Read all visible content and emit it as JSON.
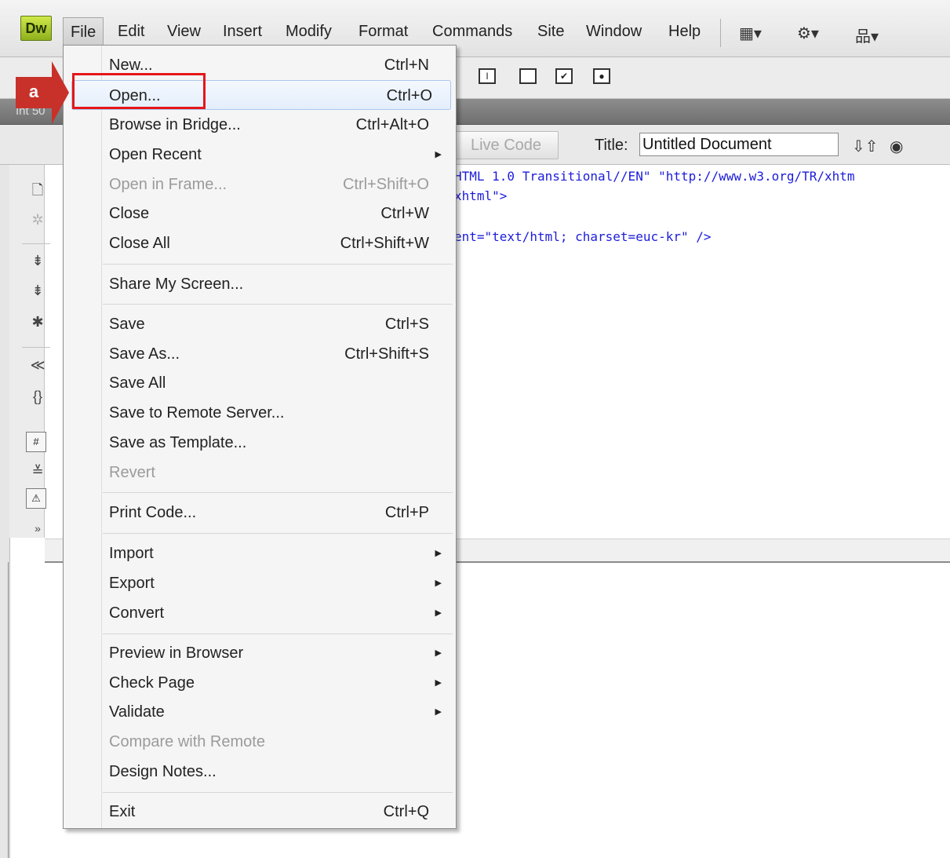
{
  "app": {
    "logo": "Dw"
  },
  "menubar": {
    "items": [
      "File",
      "Edit",
      "View",
      "Insert",
      "Modify",
      "Format",
      "Commands",
      "Site",
      "Window",
      "Help"
    ]
  },
  "doc": {
    "tab_label": "Int 50",
    "live_code_label": "Live Code",
    "title_label": "Title:",
    "title_value": "Untitled Document",
    "code_lines": [
      "HTML 1.0 Transitional//EN\" \"http://www.w3.org/TR/xhtm",
      "xhtml\">",
      "ent=\"text/html; charset=euc-kr\" />"
    ]
  },
  "callout": {
    "label": "a",
    "color": "#c8312a",
    "highlight_color": "#e5161a"
  },
  "file_menu": {
    "items": [
      {
        "label": "New...",
        "shortcut": "Ctrl+N"
      },
      {
        "label": "Open...",
        "shortcut": "Ctrl+O",
        "highlighted": true
      },
      {
        "label": "Browse in Bridge...",
        "shortcut": "Ctrl+Alt+O"
      },
      {
        "label": "Open Recent",
        "submenu": true
      },
      {
        "label": "Open in Frame...",
        "shortcut": "Ctrl+Shift+O",
        "disabled": true
      },
      {
        "label": "Close",
        "shortcut": "Ctrl+W"
      },
      {
        "label": "Close All",
        "shortcut": "Ctrl+Shift+W"
      },
      {
        "label": "Share My Screen..."
      },
      {
        "label": "Save",
        "shortcut": "Ctrl+S"
      },
      {
        "label": "Save As...",
        "shortcut": "Ctrl+Shift+S"
      },
      {
        "label": "Save All"
      },
      {
        "label": "Save to Remote Server..."
      },
      {
        "label": "Save as Template..."
      },
      {
        "label": "Revert",
        "disabled": true
      },
      {
        "label": "Print Code...",
        "shortcut": "Ctrl+P"
      },
      {
        "label": "Import",
        "submenu": true
      },
      {
        "label": "Export",
        "submenu": true
      },
      {
        "label": "Convert",
        "submenu": true
      },
      {
        "label": "Preview in Browser",
        "submenu": true
      },
      {
        "label": "Check Page",
        "submenu": true
      },
      {
        "label": "Validate",
        "submenu": true
      },
      {
        "label": "Compare with Remote",
        "disabled": true
      },
      {
        "label": "Design Notes..."
      },
      {
        "label": "Exit",
        "shortcut": "Ctrl+Q"
      }
    ]
  }
}
